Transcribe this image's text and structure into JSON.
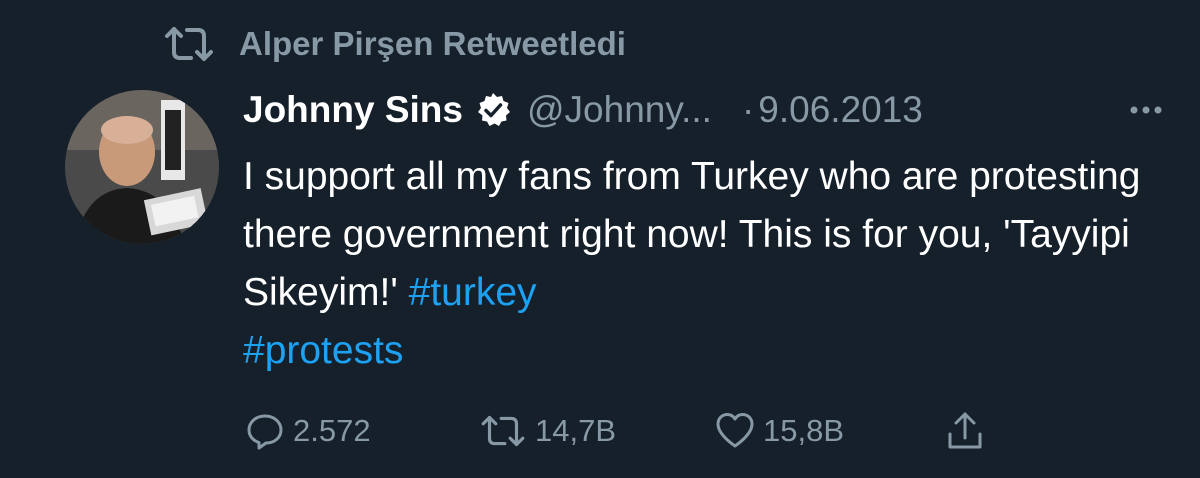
{
  "retweet_banner": {
    "icon": "retweet-icon",
    "text": "Alper Pirşen Retweetledi"
  },
  "author": {
    "avatar_icon": "avatar-photo",
    "display_name": "Johnny Sins",
    "verified_icon": "verified-badge-icon",
    "handle": "@Johnny...",
    "separator": "·",
    "date": "9.06.2013"
  },
  "more_icon": "more-options-icon",
  "tweet": {
    "text_part1": "I support all my fans from Turkey who are protesting there government right now! This is for you, 'Tayyipi Sikeyim!' ",
    "hashtag1": "#turkey",
    "hashtag2": "#protests"
  },
  "actions": {
    "reply": {
      "icon": "reply-icon",
      "count": "2.572"
    },
    "retweet": {
      "icon": "retweet-icon",
      "count": "14,7B"
    },
    "like": {
      "icon": "heart-icon",
      "count": "15,8B"
    },
    "share": {
      "icon": "share-icon"
    }
  },
  "colors": {
    "background": "#15202b",
    "secondary_text": "#8899a6",
    "link": "#1da1f2",
    "primary_text": "#ffffff"
  }
}
